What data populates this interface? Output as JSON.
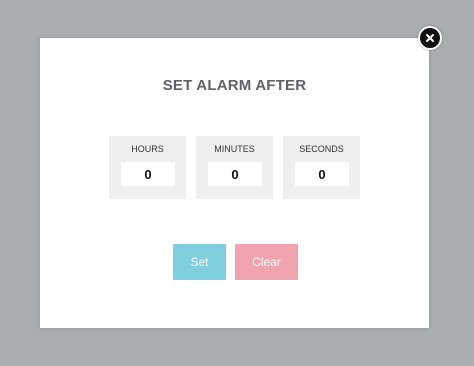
{
  "dialog": {
    "title": "SET ALARM AFTER",
    "fields": [
      {
        "label": "HOURS",
        "value": "0"
      },
      {
        "label": "MINUTES",
        "value": "0"
      },
      {
        "label": "SECONDS",
        "value": "0"
      }
    ],
    "set_label": "Set",
    "clear_label": "Clear",
    "close_icon": "close-icon"
  },
  "colors": {
    "overlay": "#a9aeb1",
    "set_button": "#7fcfe0",
    "clear_button": "#f1a4b0",
    "field_background": "#efefef",
    "title_text": "#5f6266"
  }
}
